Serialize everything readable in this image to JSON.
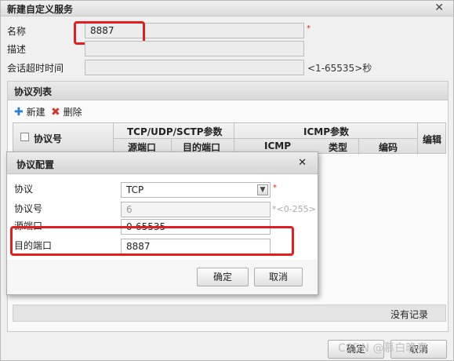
{
  "dialog": {
    "title": "新建自定义服务",
    "fields": {
      "name_label": "名称",
      "name_value": "8887",
      "desc_label": "描述",
      "desc_value": "",
      "timeout_label": "会话超时时间",
      "timeout_value": "",
      "timeout_hint": "<1-65535>秒",
      "required_mark": "*"
    },
    "buttons": {
      "ok": "确定",
      "cancel": "取消"
    }
  },
  "protocol_list": {
    "title": "协议列表",
    "toolbar": {
      "add": "新建",
      "delete": "删除"
    },
    "columns": {
      "protocol_no": "协议号",
      "tcp_group": "TCP/UDP/SCTP参数",
      "src_port": "源端口",
      "dst_port": "目的端口",
      "icmp_group": "ICMP参数",
      "icmp": "ICMP",
      "type": "类型",
      "code": "编码",
      "edit": "编辑"
    },
    "empty_text": "没有记录"
  },
  "protocol_config": {
    "title": "协议配置",
    "protocol_label": "协议",
    "protocol_value": "TCP",
    "protocol_no_label": "协议号",
    "protocol_no_value": "6",
    "protocol_no_hint": "*<0-255>",
    "src_port_label": "源端口",
    "src_port_value": "0-65535",
    "dst_port_label": "目的端口",
    "dst_port_value": "8887",
    "required_mark": "*",
    "buttons": {
      "ok": "确定",
      "cancel": "取消"
    }
  },
  "watermark": "CSDN @慕白晚春",
  "colors": {
    "highlight": "#e02020"
  }
}
